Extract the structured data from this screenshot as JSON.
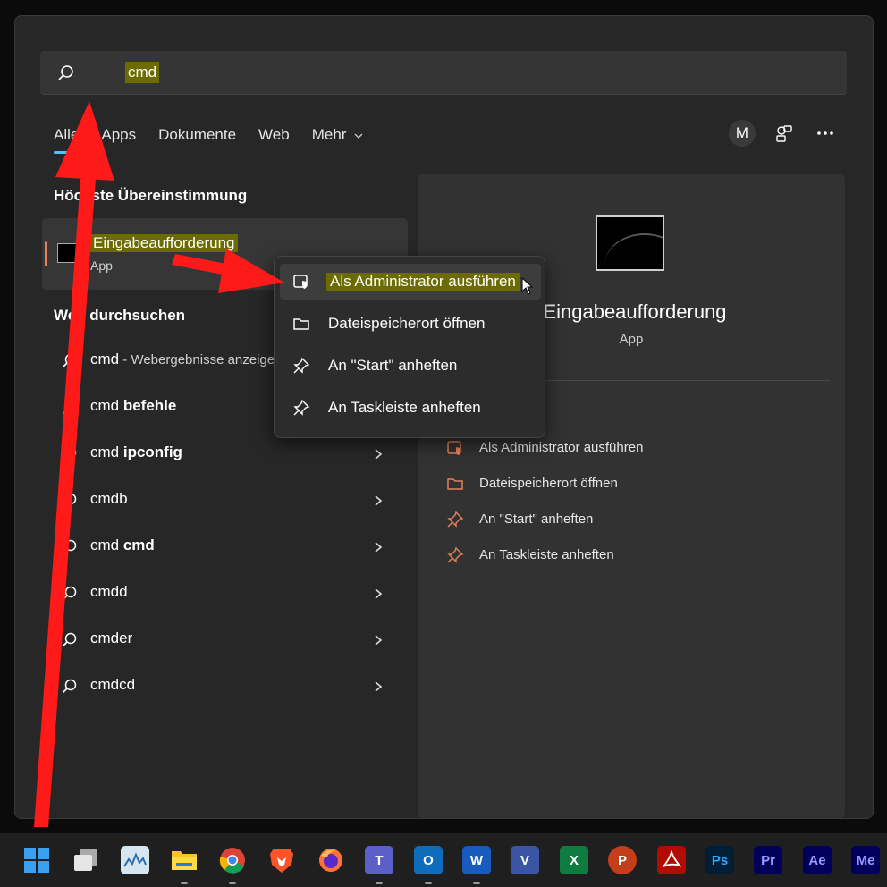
{
  "search": {
    "query": "cmd"
  },
  "tabs": [
    {
      "label": "Alle"
    },
    {
      "label": "Apps"
    },
    {
      "label": "Dokumente"
    },
    {
      "label": "Web"
    },
    {
      "label": "Mehr"
    }
  ],
  "account": {
    "initial": "M"
  },
  "best_match": {
    "section_title": "Höchste Übereinstimmung",
    "name": "Eingabeaufforderung",
    "type": "App"
  },
  "web": {
    "section_title": "Web durchsuchen",
    "items": [
      {
        "plain": "cmd",
        "bold": "",
        "sub": " - Webergebnisse anzeigen"
      },
      {
        "plain": "cmd ",
        "bold": "befehle",
        "sub": ""
      },
      {
        "plain": "cmd ",
        "bold": "ipconfig",
        "sub": ""
      },
      {
        "plain": "cmdb",
        "bold": "",
        "sub": ""
      },
      {
        "plain": "cmd ",
        "bold": "cmd",
        "sub": ""
      },
      {
        "plain": "cmdd",
        "bold": "",
        "sub": ""
      },
      {
        "plain": "cmder",
        "bold": "",
        "sub": ""
      },
      {
        "plain": "cmdcd",
        "bold": "",
        "sub": ""
      }
    ]
  },
  "context_menu": {
    "items": [
      {
        "label": "Als Administrator ausführen",
        "icon": "shield-window-icon"
      },
      {
        "label": "Dateispeicherort öffnen",
        "icon": "folder-icon"
      },
      {
        "label": "An \"Start\" anheften",
        "icon": "pin-icon"
      },
      {
        "label": "An Taskleiste anheften",
        "icon": "pin-icon"
      }
    ]
  },
  "preview": {
    "title": "Eingabeaufforderung",
    "type": "App",
    "actions": [
      {
        "label": "Als Administrator ausführen",
        "icon": "shield-window-icon"
      },
      {
        "label": "Dateispeicherort öffnen",
        "icon": "folder-icon"
      },
      {
        "label": "An \"Start\" anheften",
        "icon": "pin-icon"
      },
      {
        "label": "An Taskleiste anheften",
        "icon": "pin-icon"
      }
    ]
  },
  "taskbar": {
    "apps": [
      {
        "name": "start-icon",
        "label": ""
      },
      {
        "name": "task-view-icon",
        "label": ""
      },
      {
        "name": "resource-monitor-icon",
        "label": ""
      },
      {
        "name": "file-explorer-icon",
        "label": ""
      },
      {
        "name": "chrome-icon",
        "label": ""
      },
      {
        "name": "brave-icon",
        "label": ""
      },
      {
        "name": "firefox-icon",
        "label": ""
      },
      {
        "name": "teams-icon",
        "label": "T"
      },
      {
        "name": "outlook-icon",
        "label": "O"
      },
      {
        "name": "word-icon",
        "label": "W"
      },
      {
        "name": "visio-icon",
        "label": "V"
      },
      {
        "name": "excel-icon",
        "label": "X"
      },
      {
        "name": "powerpoint-icon",
        "label": "P"
      },
      {
        "name": "acrobat-icon",
        "label": ""
      },
      {
        "name": "photoshop-icon",
        "label": "Ps"
      },
      {
        "name": "premiere-icon",
        "label": "Pr"
      },
      {
        "name": "after-effects-icon",
        "label": "Ae"
      },
      {
        "name": "media-encoder-icon",
        "label": "Me"
      }
    ]
  },
  "colors": {
    "accent": "#4cc2ff",
    "highlight": "#6b6b00",
    "annotation_arrow": "#ff1a1a",
    "action_icon": "#e8805a"
  }
}
